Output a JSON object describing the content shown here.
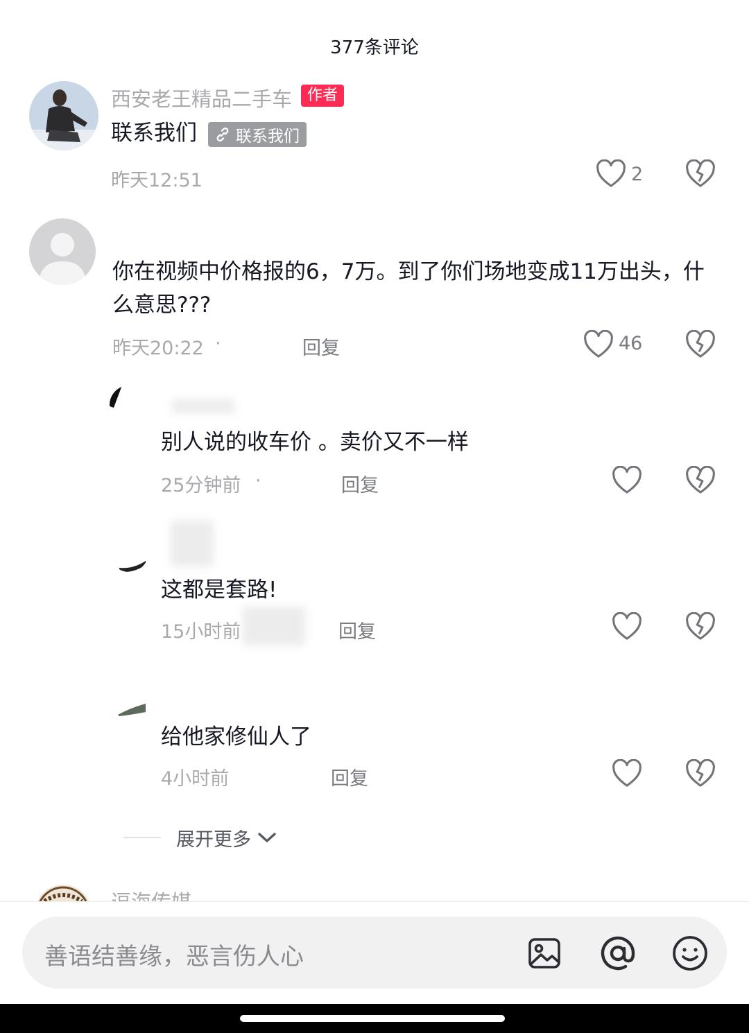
{
  "header": {
    "title": "377条评论"
  },
  "comments": [
    {
      "nickname": "西安老王精品二手车",
      "badge": "作者",
      "text": "联系我们",
      "link_chip": "联系我们",
      "time": "昨天12:51",
      "likes": "2"
    },
    {
      "text_line1": "你在视频中价格报的6，7万。到了你们场地变成11万出头，什",
      "text_line2": "么意思???",
      "time": "昨天20:22",
      "dot": "·",
      "reply": "回复",
      "likes": "46"
    }
  ],
  "replies": [
    {
      "text": "别人说的收车价 。卖价又不一样",
      "time": "25分钟前",
      "dot": "·",
      "reply": "回复"
    },
    {
      "text": "这都是套路!",
      "time": "15小时前",
      "reply": "回复"
    },
    {
      "text": "给他家修仙人了",
      "time": "4小时前",
      "reply": "回复"
    }
  ],
  "expand": {
    "label": "展开更多"
  },
  "next_comment": {
    "nickname": "逗海传媒"
  },
  "input": {
    "placeholder": "善语结善缘，恶言伤人心"
  },
  "colors": {
    "accent": "#fe2c55",
    "gray_text": "#a8a9ad",
    "input_bg": "#f1f1f2"
  },
  "icons": [
    "heart-outline-icon",
    "broken-heart-icon",
    "link-icon",
    "image-icon",
    "at-icon",
    "emoji-icon",
    "chevron-down-icon"
  ]
}
